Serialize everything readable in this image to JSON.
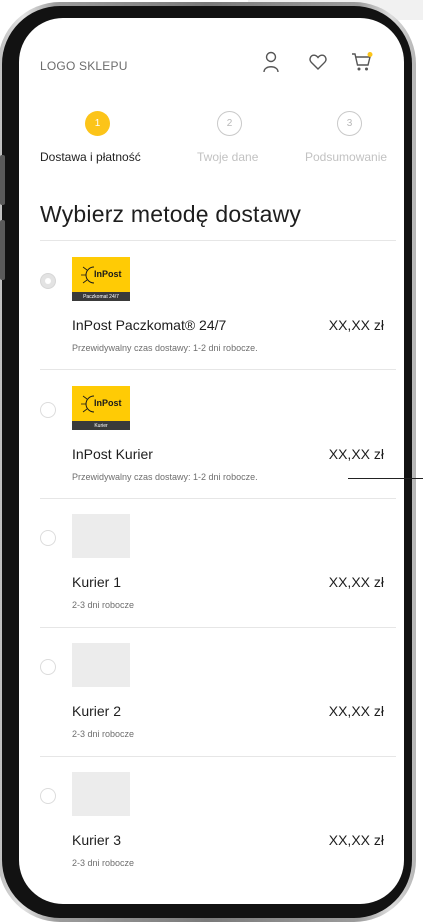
{
  "header": {
    "logo_text": "LOGO SKLEPU",
    "icons": [
      "user-icon",
      "heart-icon",
      "cart-icon"
    ]
  },
  "stepper": {
    "steps": [
      {
        "number": "1",
        "label": "Dostawa i płatność",
        "active": true
      },
      {
        "number": "2",
        "label": "Twoje dane",
        "active": false
      },
      {
        "number": "3",
        "label": "Podsumowanie",
        "active": false
      }
    ]
  },
  "page_title": "Wybierz metodę dostawy",
  "delivery_options": [
    {
      "logo_text": "InPost",
      "logo_sub": "Paczkomat 24/7",
      "name": "InPost Paczkomat® 24/7",
      "price": "XX,XX zł",
      "description": "Przewidywalny czas dostawy: 1-2 dni robocze.",
      "selected": true
    },
    {
      "logo_text": "InPost",
      "logo_sub": "Kurier",
      "name": "InPost Kurier",
      "price": "XX,XX zł",
      "description": "Przewidywalny czas dostawy: 1-2 dni robocze.",
      "selected": false
    },
    {
      "name": "Kurier 1",
      "price": "XX,XX zł",
      "description": "2-3 dni robocze",
      "selected": false
    },
    {
      "name": "Kurier 2",
      "price": "XX,XX zł",
      "description": "2-3 dni robocze",
      "selected": false
    },
    {
      "name": "Kurier 3",
      "price": "XX,XX zł",
      "description": "2-3 dni robocze",
      "selected": false
    }
  ],
  "colors": {
    "accent": "#fcc419",
    "inpost_yellow": "#ffcb05",
    "frame": "#121212",
    "placeholder": "#ececec"
  }
}
